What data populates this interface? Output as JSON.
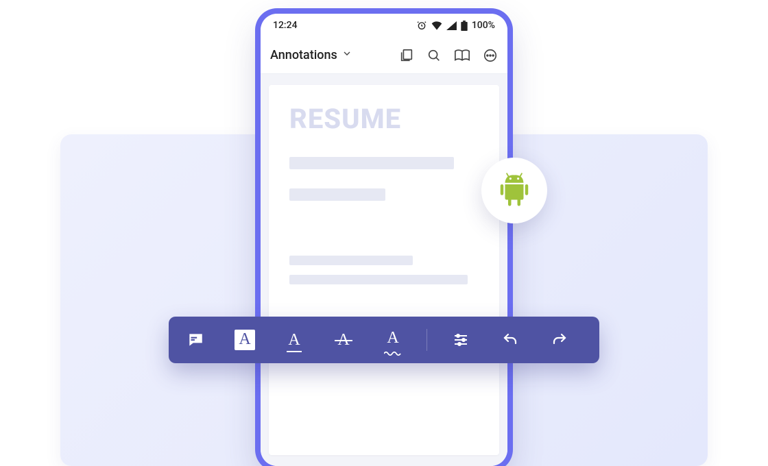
{
  "statusbar": {
    "time": "12:24",
    "battery_pct": "100%"
  },
  "appbar": {
    "title": "Annotations"
  },
  "document": {
    "heading": "RESUME"
  },
  "toolbar": {
    "items": [
      {
        "name": "comment"
      },
      {
        "name": "highlight"
      },
      {
        "name": "underline"
      },
      {
        "name": "strikethrough"
      },
      {
        "name": "squiggle"
      },
      {
        "name": "sliders"
      },
      {
        "name": "undo"
      },
      {
        "name": "redo"
      }
    ]
  },
  "platform": {
    "badge": "android"
  }
}
